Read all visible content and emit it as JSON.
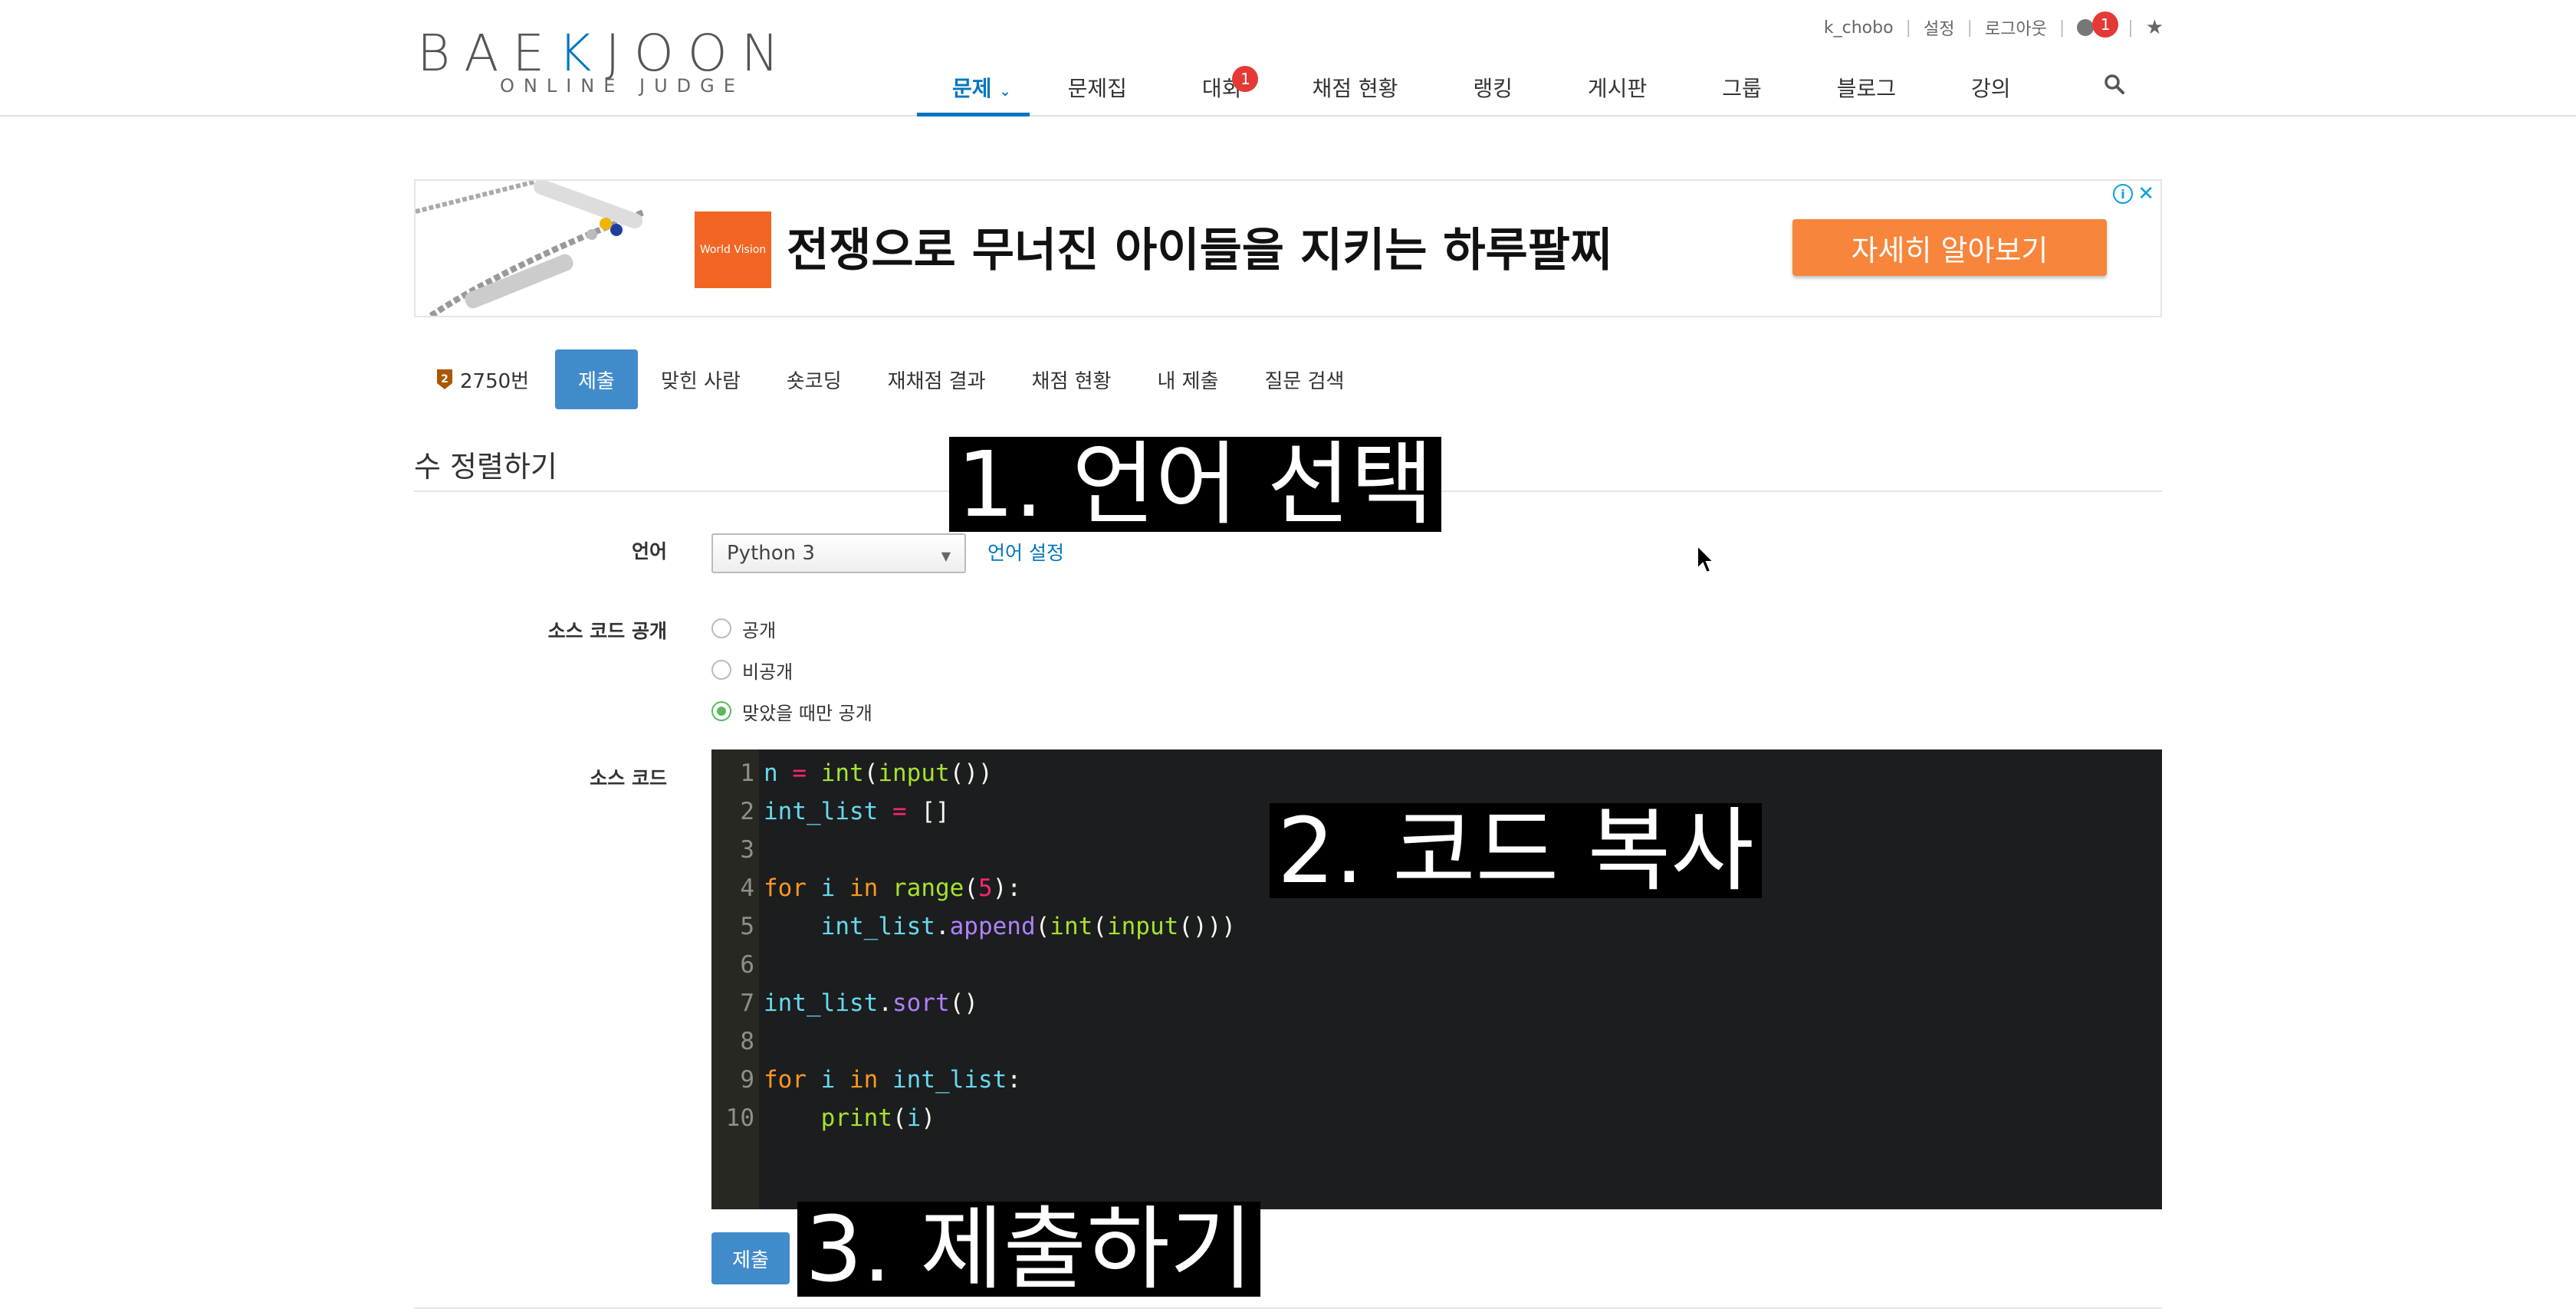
{
  "header": {
    "logo_main_left": "BAE",
    "logo_main_accent": "K",
    "logo_main_right": "JOON",
    "logo_sub": "ONLINE JUDGE",
    "top_links": {
      "username": "k_chobo",
      "settings": "설정",
      "logout": "로그아웃",
      "notification_count": "1"
    },
    "nav": [
      {
        "label": "문제",
        "active": true
      },
      {
        "label": "문제집"
      },
      {
        "label": "대회",
        "badge": "1"
      },
      {
        "label": "채점 현황"
      },
      {
        "label": "랭킹"
      },
      {
        "label": "게시판"
      },
      {
        "label": "그룹"
      },
      {
        "label": "블로그"
      },
      {
        "label": "강의"
      }
    ]
  },
  "ad": {
    "logo_text": "World Vision",
    "headline": "전쟁으로 무너진 아이들을 지키는 하루팔찌",
    "cta": "자세히 알아보기"
  },
  "problem_tabs": {
    "number": "2750번",
    "submit": "제출",
    "solved": "맞힌 사람",
    "shortcoding": "숏코딩",
    "rejudge": "재채점 결과",
    "status": "채점 현황",
    "my_submissions": "내 제출",
    "questions": "질문 검색"
  },
  "problem_title": "수 정렬하기",
  "form": {
    "language_label": "언어",
    "language_value": "Python 3",
    "language_settings": "언어 설정",
    "visibility_label": "소스 코드 공개",
    "visibility_options": [
      "공개",
      "비공개",
      "맞았을 때만 공개"
    ],
    "visibility_selected": "맞았을 때만 공개",
    "source_label": "소스 코드",
    "submit_label": "제출"
  },
  "code_lines": [
    "n = int(input())",
    "int_list = []",
    "",
    "for i in range(5):",
    "    int_list.append(int(input()))",
    "",
    "int_list.sort()",
    "",
    "for i in int_list:",
    "    print(i)"
  ],
  "overlays": {
    "step1": "1. 언어 선택",
    "step2": "2. 코드 복사",
    "step3": "3. 제출하기"
  },
  "colors": {
    "accent": "#0076c0",
    "button": "#428bca",
    "badge": "#e53935",
    "editor_bg": "#1b1d1e",
    "ad_cta": "#f7853b"
  }
}
